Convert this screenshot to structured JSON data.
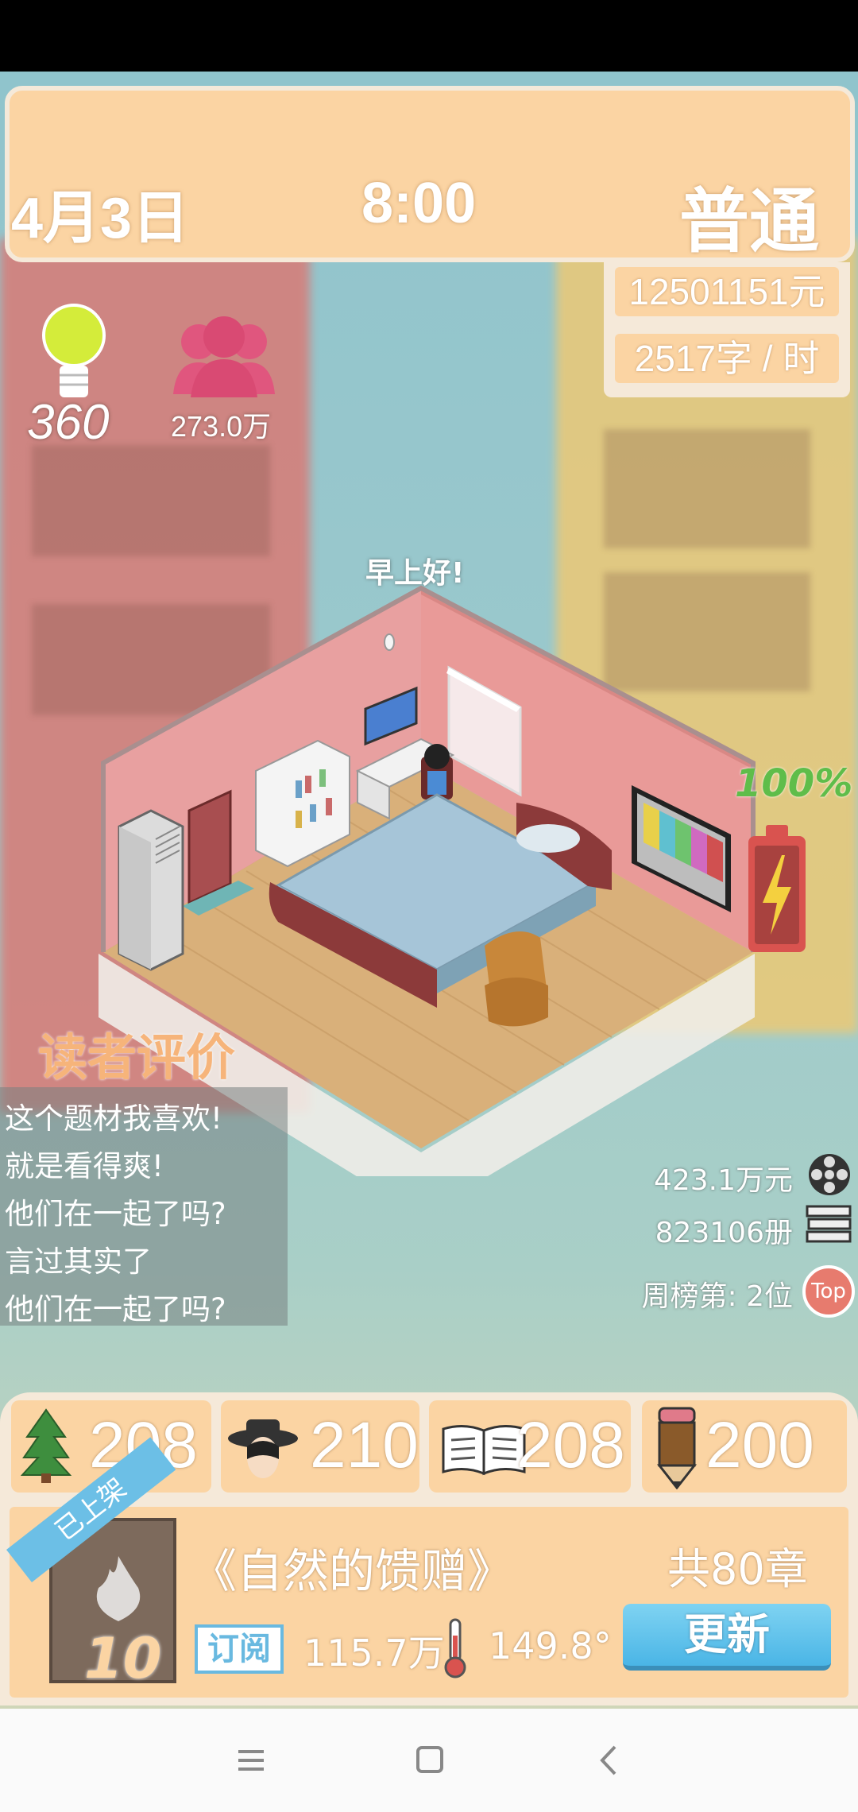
{
  "header": {
    "date": "4月3日",
    "time": "8:00",
    "mode": "普通"
  },
  "finance": {
    "money": "12501151元",
    "speed": "2517字 / 时"
  },
  "stats": {
    "idea_value": "360",
    "fans": "273.0万"
  },
  "room": {
    "greeting": "早上好!",
    "battery": "100%"
  },
  "reviews": {
    "title": "读者评价",
    "items": [
      "这个题材我喜欢!",
      "就是看得爽!",
      "他们在一起了吗?",
      "言过其实了",
      "他们在一起了吗?"
    ]
  },
  "sales": {
    "income": "423.1万元",
    "copies": "823106册",
    "rank": "周榜第: 2位",
    "rank_badge": "Top"
  },
  "attributes": [
    {
      "icon": "tree-icon",
      "value": "208"
    },
    {
      "icon": "detective-icon",
      "value": "210"
    },
    {
      "icon": "book-icon",
      "value": "208"
    },
    {
      "icon": "pencil-icon",
      "value": "200"
    }
  ],
  "book": {
    "ribbon": "已上架",
    "cover_number": "10",
    "title": "《自然的馈赠》",
    "chapters": "共80章",
    "subscribe_label": "订阅",
    "subscribers": "115.7万",
    "heat": "149.8°",
    "update_label": "更新"
  },
  "colors": {
    "panel": "#fbd4a3",
    "panel_border": "#f5e9d9",
    "accent_blue": "#4ab5e6",
    "fans_pink": "#e0567e",
    "battery_red": "#d9534f"
  }
}
